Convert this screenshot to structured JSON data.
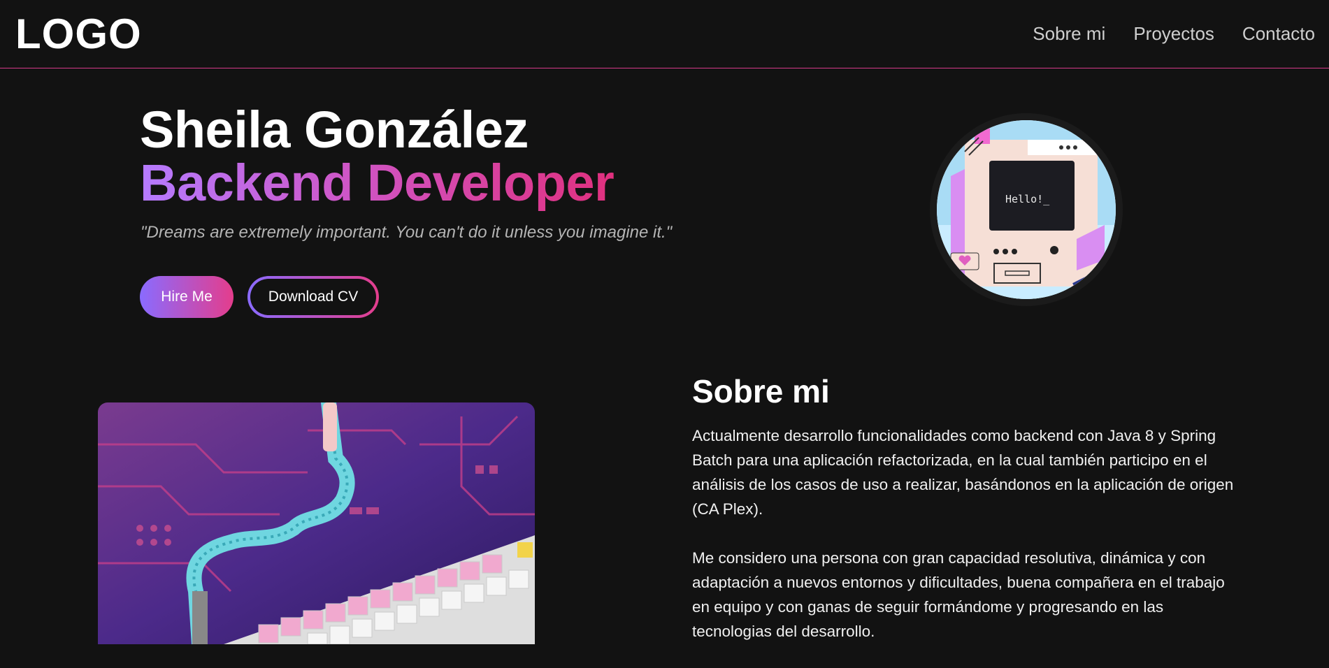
{
  "nav": {
    "logo": "LOGO",
    "links": [
      "Sobre mi",
      "Proyectos",
      "Contacto"
    ]
  },
  "hero": {
    "name": "Sheila González",
    "role": "Backend Developer",
    "quote": "\"Dreams are extremely important. You can't do it unless you imagine it.\"",
    "hire_label": "Hire Me",
    "cv_label": "Download CV",
    "avatar_screen_text": "Hello!_"
  },
  "about": {
    "title": "Sobre mi",
    "paragraphs": [
      "Actualmente desarrollo funcionalidades como backend con Java 8 y Spring Batch para una aplicación refactorizada, en la cual también participo en el análisis de los casos de uso a realizar, basándonos en la aplicación de origen (CA Plex).",
      "Me considero una persona con gran capacidad resolutiva, dinámica y con adaptación a nuevos entornos y dificultades, buena compañera en el trabajo en equipo y con ganas de seguir formándome y progresando en las tecnologias del desarrollo."
    ]
  },
  "colors": {
    "background": "#121212",
    "accent_purple": "#8a6bff",
    "accent_pink": "#e43d8c",
    "nav_border": "#d63a8a"
  }
}
